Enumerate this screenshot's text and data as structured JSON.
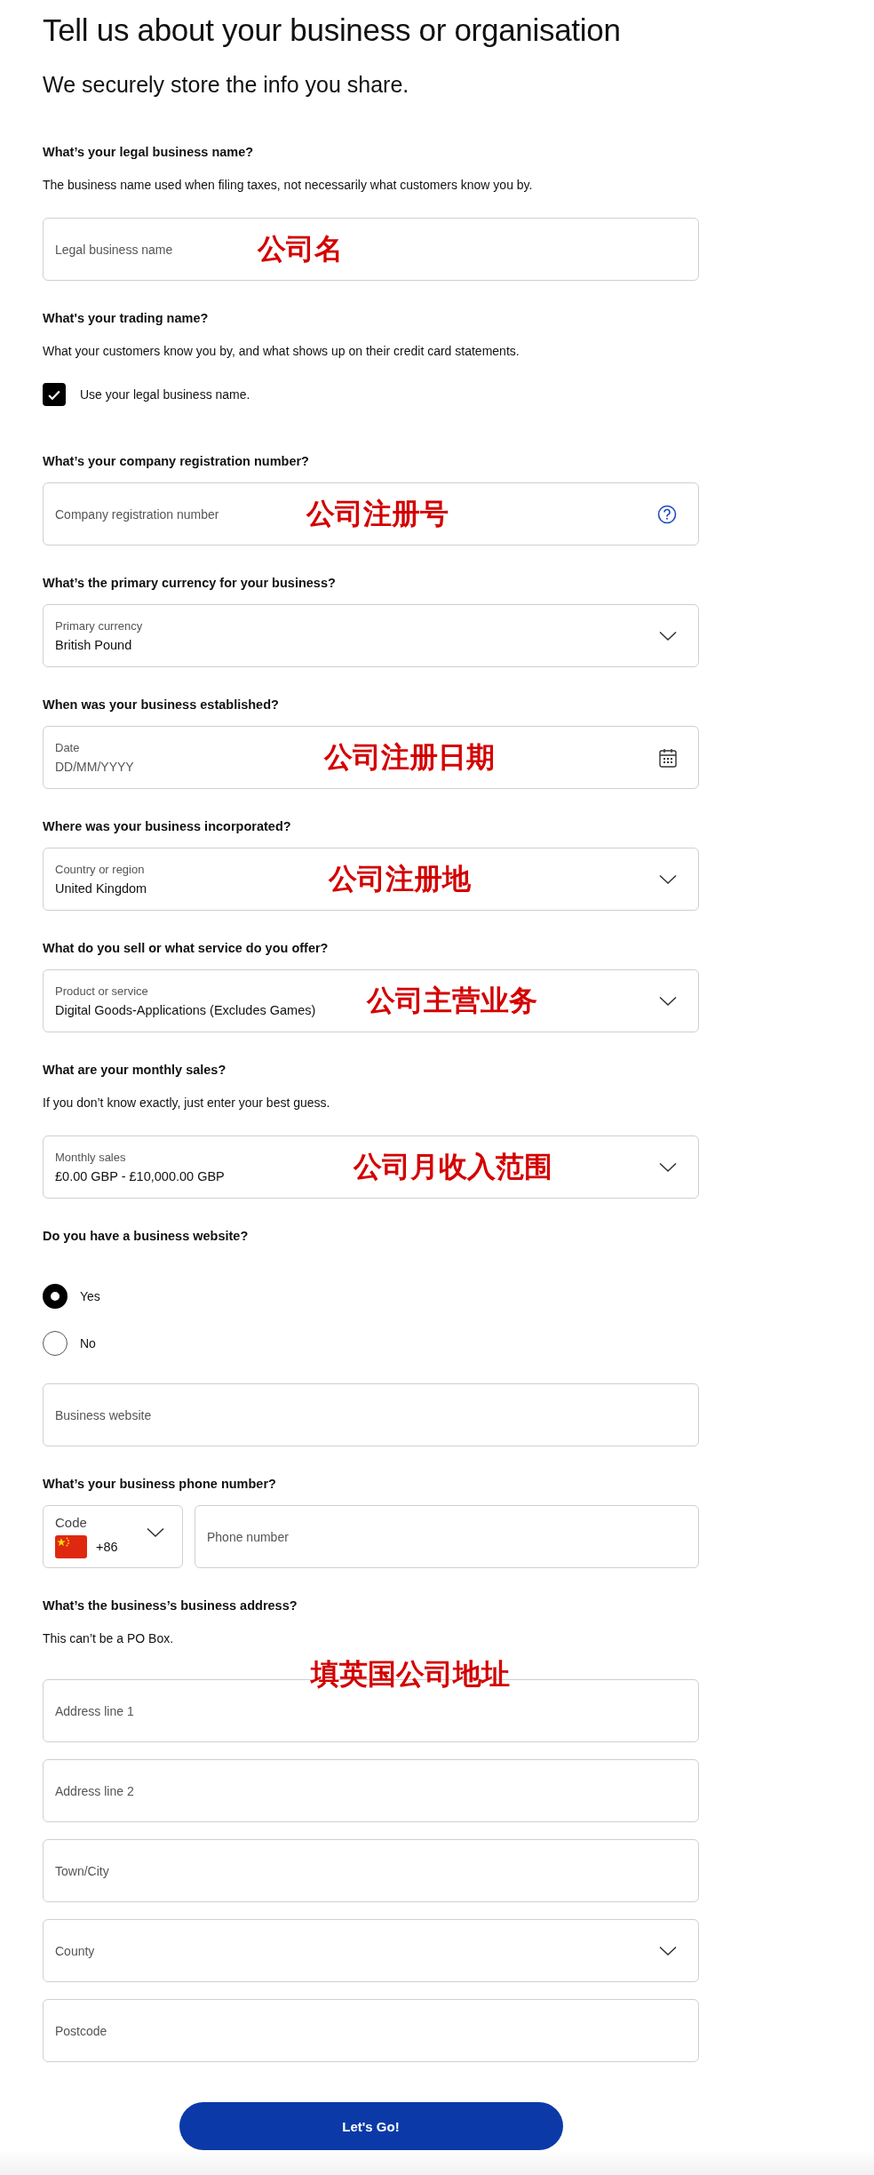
{
  "title": "Tell us about your business or organisation",
  "subtitle": "We securely store the info you share.",
  "sections": [
    {
      "heading": "What’s your legal business name?",
      "description": "The business name used when filing taxes, not necessarily what customers know you by.",
      "fields": [
        {
          "kind": "input",
          "placeholder": "Legal business name",
          "note": "公司名"
        }
      ]
    },
    {
      "heading": "What's your trading name?",
      "description": "What your customers know you by, and what shows up on their credit card statements.",
      "checkbox": {
        "label": "Use your legal business name.",
        "checked": true
      }
    },
    {
      "heading": "What’s your company registration number?",
      "fields": [
        {
          "kind": "input-help",
          "placeholder": "Company registration number",
          "note": "公司注册号"
        }
      ]
    },
    {
      "heading": "What’s the primary currency for your business?",
      "fields": [
        {
          "kind": "select",
          "label": "Primary currency",
          "value": "British Pound"
        }
      ]
    },
    {
      "heading": "When was your business established?",
      "fields": [
        {
          "kind": "date",
          "label": "Date",
          "placeholder": "DD/MM/YYYY",
          "note": "公司注册日期"
        }
      ]
    },
    {
      "heading": "Where was your business incorporated?",
      "fields": [
        {
          "kind": "select",
          "label": "Country or region",
          "value": "United Kingdom",
          "note": "公司注册地"
        }
      ]
    },
    {
      "heading": "What do you sell or what service do you offer?",
      "fields": [
        {
          "kind": "select",
          "label": "Product or service",
          "value": "Digital Goods-Applications (Excludes Games)",
          "note": "公司主营业务"
        }
      ]
    },
    {
      "heading": "What are your monthly sales?",
      "description": "If you don’t know exactly, just enter your best guess.",
      "fields": [
        {
          "kind": "select",
          "label": "Monthly sales",
          "value": "£0.00 GBP - £10,000.00 GBP",
          "note": "公司月收入范围"
        }
      ]
    },
    {
      "heading": "Do you have a business website?",
      "radios": [
        {
          "label": "Yes",
          "selected": true
        },
        {
          "label": "No",
          "selected": false
        }
      ],
      "fields": [
        {
          "kind": "input",
          "placeholder": "Business website"
        }
      ]
    },
    {
      "heading": "What’s your business phone number?",
      "fields": [
        {
          "kind": "code",
          "label": "Code",
          "value": "+86"
        },
        {
          "kind": "input",
          "placeholder": "Phone number"
        }
      ]
    },
    {
      "heading": "What’s the business’s business address?",
      "description": "This can’t be a PO Box.",
      "note": "填英国公司地址",
      "fields": [
        {
          "kind": "input",
          "placeholder": "Address line 1"
        },
        {
          "kind": "input",
          "placeholder": "Address line 2"
        },
        {
          "kind": "input",
          "placeholder": "Town/City"
        },
        {
          "kind": "select",
          "placeholder": "County"
        },
        {
          "kind": "input",
          "placeholder": "Postcode"
        }
      ]
    }
  ],
  "button": "Let's Go!"
}
